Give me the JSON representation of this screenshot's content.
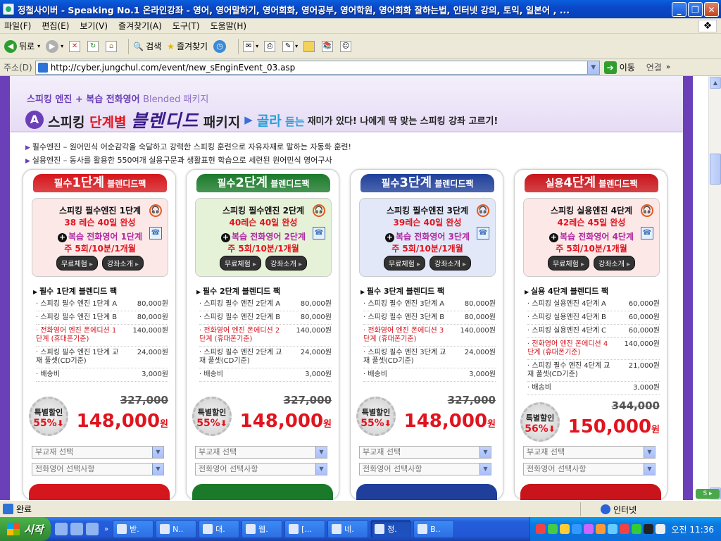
{
  "window": {
    "title": "정철사이버 - Speaking No.1 온라인강좌 - 영어, 영어말하기, 영어회화, 영어공부, 영어학원, 영어회화 잘하는법, 인터넷 강의, 토익, 일본어 , ..."
  },
  "menu": [
    "파일(F)",
    "편집(E)",
    "보기(V)",
    "즐겨찾기(A)",
    "도구(T)",
    "도움말(H)"
  ],
  "toolbar": {
    "back": "뒤로",
    "search": "검색",
    "favorites": "즐겨찾기"
  },
  "address": {
    "label": "주소(D)",
    "url": "http://cyber.jungchul.com/event/new_sEnginEvent_03.asp",
    "go": "이동",
    "links": "연결"
  },
  "header": {
    "subtitle": "스피킹 엔진 + 복습 전화영어",
    "subtitle_em": "Blended 패키지",
    "badge": "A",
    "t_pre": "스피킹 ",
    "t_red": "단계별",
    "t_big": "블렌디드",
    "t_post": " 패키지",
    "golra": "골라",
    "golra2": " 듣는",
    "rest": "재미가 있다!  나에게  딱 맞는 스피킹 강좌 고르기!"
  },
  "bullets": [
    "필수엔진 – 원어민식 어순감각을 숙달하고 강력한 스피킹 훈련으로 자유자재로 말하는 자동화 훈련!",
    "실용엔진 – 동사를 활용한 550여개 실용구문과 생활표현 학습으로 세련된 원어민식 영어구사"
  ],
  "packages": [
    {
      "tab_pre": "필수",
      "tab_lg": "1단계",
      "tab_sm": " 블렌디드팩",
      "color": "#d5161c",
      "boxbg": "#fde8e8",
      "l1": "스피킹 필수엔진 1단계",
      "l2": "38 레슨 40일 완성",
      "l3": "복습 전화영어 1단계",
      "l4": "주 5회/10분/1개월",
      "b1": "무료체험",
      "b2": "강좌소개",
      "ptitle": "필수 1단계 블렌디드 팩",
      "items": [
        {
          "n": "스피킹 필수 엔진 1단계 A",
          "p": "80,000원",
          "red": false
        },
        {
          "n": "스피킹 필수 엔진 1단계 B",
          "p": "80,000원",
          "red": false
        },
        {
          "n": "전화영어 엔진 폰에디션 1단계 (휴대폰기준)",
          "p": "140,000원",
          "red": true
        },
        {
          "n": "스피킹 필수 엔진 1단계 교재 풀셋(CD기준)",
          "p": "24,000원",
          "red": false
        },
        {
          "n": "배송비",
          "p": "3,000원",
          "red": false
        }
      ],
      "seal1": "특별할인",
      "seal2": "55%",
      "orig": "327,000",
      "price": "148,000",
      "won": "원",
      "sel1": "부교재 선택",
      "sel2": "전화영어 선택사항"
    },
    {
      "tab_pre": "필수",
      "tab_lg": "2단계",
      "tab_sm": " 블렌디드팩",
      "color": "#1b7a2a",
      "boxbg": "#e6f2d8",
      "l1": "스피킹 필수엔진 2단계",
      "l2": "40레슨 40일 완성",
      "l3": "복습 전화영어 2단계",
      "l4": "주 5회/10분/1개월",
      "b1": "무료체험",
      "b2": "강좌소개",
      "ptitle": "필수 2단계 블렌디드 팩",
      "items": [
        {
          "n": "스피킹 필수 엔진 2단계 A",
          "p": "80,000원",
          "red": false
        },
        {
          "n": "스피킹 필수 엔진 2단계 B",
          "p": "80,000원",
          "red": false
        },
        {
          "n": "전화영어 엔진 폰에디션 2단계 (휴대폰기준)",
          "p": "140,000원",
          "red": true
        },
        {
          "n": "스피킹 필수 엔진 2단계 교재 풀셋(CD기준)",
          "p": "24,000원",
          "red": false
        },
        {
          "n": "배송비",
          "p": "3,000원",
          "red": false
        }
      ],
      "seal1": "특별할인",
      "seal2": "55%",
      "orig": "327,000",
      "price": "148,000",
      "won": "원",
      "sel1": "부교재 선택",
      "sel2": "전화영어 선택사항"
    },
    {
      "tab_pre": "필수",
      "tab_lg": "3단계",
      "tab_sm": " 블렌디드팩",
      "color": "#1f3f9a",
      "boxbg": "#e2e8f8",
      "l1": "스피킹 필수엔진 3단계",
      "l2": "39레슨 40일 완성",
      "l3": "복습 전화영어 3단계",
      "l4": "주 5회/10분/1개월",
      "b1": "무료체험",
      "b2": "강좌소개",
      "ptitle": "필수 3단계 블렌디드 팩",
      "items": [
        {
          "n": "스피킹 필수 엔진 3단계 A",
          "p": "80,000원",
          "red": false
        },
        {
          "n": "스피킹 필수 엔진 3단계 B",
          "p": "80,000원",
          "red": false
        },
        {
          "n": "전화영어 엔진 폰에디션 3단계 (휴대폰기준)",
          "p": "140,000원",
          "red": true
        },
        {
          "n": "스피킹 필수 엔진 3단계 교재 풀셋(CD기준)",
          "p": "24,000원",
          "red": false
        },
        {
          "n": "배송비",
          "p": "3,000원",
          "red": false
        }
      ],
      "seal1": "특별할인",
      "seal2": "55%",
      "orig": "327,000",
      "price": "148,000",
      "won": "원",
      "sel1": "부교재 선택",
      "sel2": "전화영어 선택사항"
    },
    {
      "tab_pre": "실용",
      "tab_lg": "4단계",
      "tab_sm": " 블렌디드팩",
      "color": "#c8141a",
      "boxbg": "#fde8e8",
      "l1": "스피킹 실용엔진 4단계",
      "l2": "42레슨 45일 완성",
      "l3": "복습 전화영어 4단계",
      "l4": "주 5회/10분/1개월",
      "b1": "무료체험",
      "b2": "강좌소개",
      "ptitle": "실용 4단계 블렌디드 팩",
      "items": [
        {
          "n": "스피킹 실용엔진 4단계 A",
          "p": "60,000원",
          "red": false
        },
        {
          "n": "스피킹 실용엔진 4단계 B",
          "p": "60,000원",
          "red": false
        },
        {
          "n": "스피킹 실용엔진 4단계 C",
          "p": "60,000원",
          "red": false
        },
        {
          "n": "전화영어 엔진 폰에디션 4단계 (휴대폰기준)",
          "p": "140,000원",
          "red": true
        },
        {
          "n": "스피킹 필수 엔진 4단계 교재 풀셋(CD기준)",
          "p": "21,000원",
          "red": false
        },
        {
          "n": "배송비",
          "p": "3,000원",
          "red": false
        }
      ],
      "seal1": "특별할인",
      "seal2": "56%",
      "orig": "344,000",
      "price": "150,000",
      "won": "원",
      "sel1": "부교재 선택",
      "sel2": "전화영어 선택사항"
    }
  ],
  "status": {
    "text": "완료",
    "zone": "인터넷"
  },
  "taskbar": {
    "start": "시작",
    "tasks": [
      "받.",
      "N..",
      "대.",
      "웹.",
      "[...",
      "네.",
      "정.",
      "B.."
    ],
    "active_index": 6,
    "clock": "오전 11:36"
  }
}
